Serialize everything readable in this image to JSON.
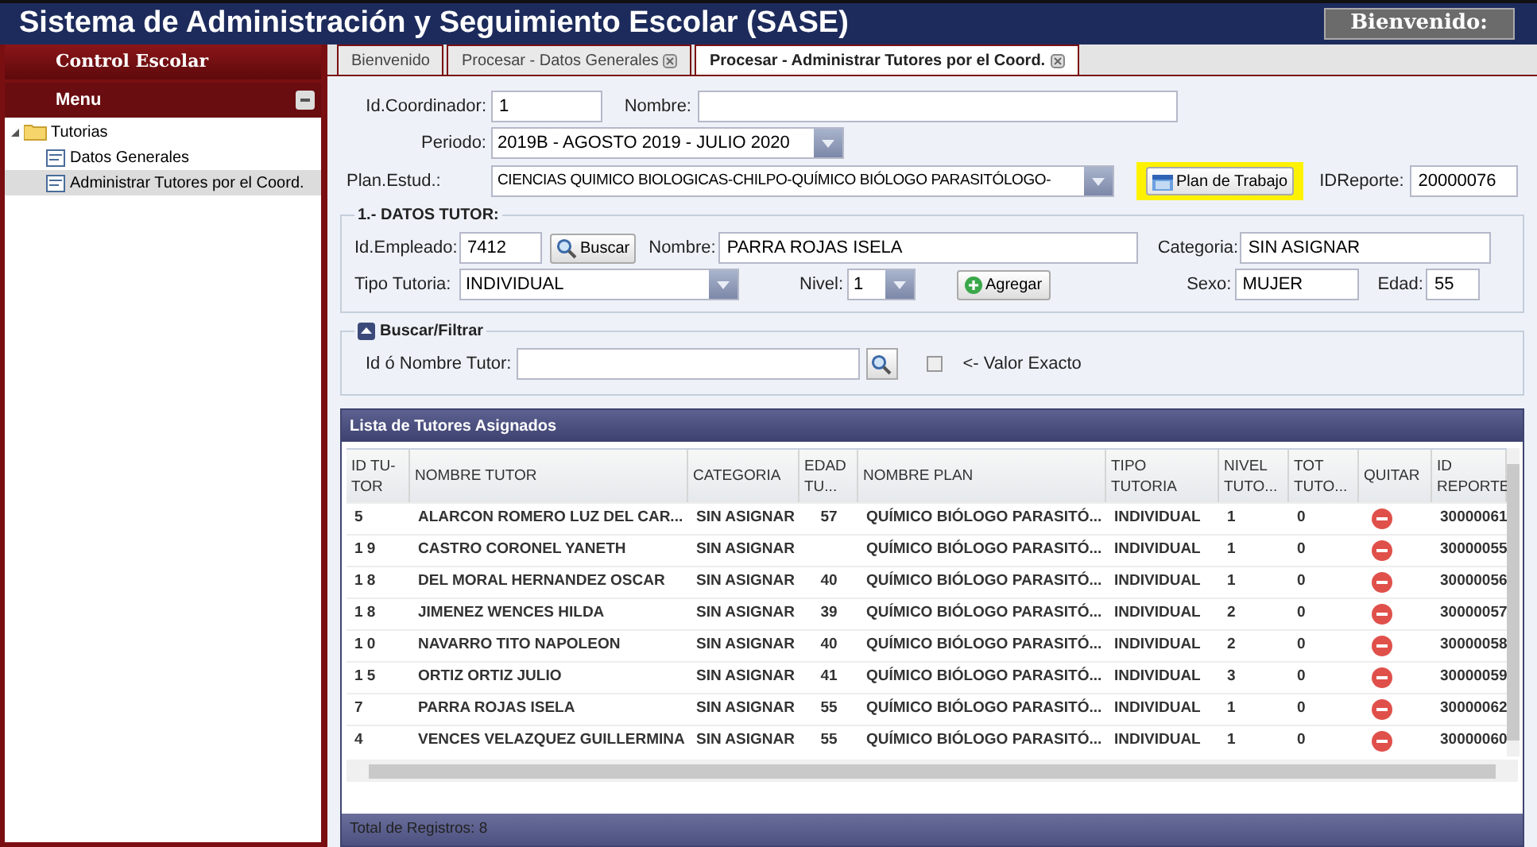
{
  "title": "Sistema de Administración y Seguimiento Escolar (SASE)",
  "welcome": "Bienvenido:",
  "sidebar": {
    "header": "Control Escolar",
    "menu": "Menu",
    "tree": [
      {
        "label": "Tutorias",
        "expanded": true,
        "children": [
          {
            "label": "Datos Generales",
            "selected": false
          },
          {
            "label": "Administrar Tutores por el Coord.",
            "selected": true
          }
        ]
      }
    ]
  },
  "tabs": [
    {
      "label": "Bienvenido",
      "closable": false,
      "selected": false
    },
    {
      "label": "Procesar - Datos Generales",
      "closable": true,
      "selected": false
    },
    {
      "label": "Procesar - Administrar Tutores por el Coord.",
      "closable": true,
      "selected": true
    }
  ],
  "form": {
    "id_coordinador": {
      "label": "Id.Coordinador:",
      "value": "1"
    },
    "nombre": {
      "label": "Nombre:"
    },
    "periodo": {
      "label": "Periodo:",
      "value": "2019B - AGOSTO 2019 - JULIO 2020"
    },
    "plan": {
      "label": "Plan.Estud.:",
      "value": "CIENCIAS QUIMICO BIOLOGICAS-CHILPO-QUÍMICO BIÓLOGO PARASITÓLOGO-"
    },
    "plan_button": "Plan de Trabajo",
    "id_reporte": {
      "label": "IDReporte:",
      "value": "20000076"
    }
  },
  "datos_tutor": {
    "legend": "1.- DATOS TUTOR:",
    "id_empleado": {
      "label": "Id.Empleado:",
      "value": "7412"
    },
    "buscar": "Buscar",
    "nombre": {
      "label": "Nombre:",
      "value": "PARRA ROJAS ISELA"
    },
    "categoria": {
      "label": "Categoria:",
      "value": "SIN ASIGNAR"
    },
    "tipo": {
      "label": "Tipo Tutoria:",
      "value": "INDIVIDUAL"
    },
    "nivel": {
      "label": "Nivel:",
      "value": "1"
    },
    "agregar": "Agregar",
    "sexo": {
      "label": "Sexo:",
      "value": "MUJER"
    },
    "edad": {
      "label": "Edad:",
      "value": "55"
    }
  },
  "filtro": {
    "legend": "Buscar/Filtrar",
    "label": "Id ó Nombre Tutor:",
    "exacto": {
      "label": "<- Valor Exacto",
      "checked": false
    }
  },
  "table": {
    "title": "Lista de Tutores Asignados",
    "columns": [
      "ID TU-TOR",
      "NOMBRE TUTOR",
      "CATEGORIA",
      "EDAD TU...",
      "NOMBRE PLAN",
      "TIPO TUTORIA",
      "NIVEL TUTO...",
      "TOT TUTO...",
      "QUITAR",
      "ID REPORTE"
    ],
    "rows": [
      {
        "id": "5",
        "nombre": "ALARCON ROMERO LUZ DEL CAR...",
        "categoria": "SIN ASIGNAR",
        "edad": "57",
        "plan": "QUÍMICO BIÓLOGO PARASITÓ...",
        "tipo": "INDIVIDUAL",
        "nivel": "1",
        "tot": "0",
        "reporte": "30000061"
      },
      {
        "id": "1 9",
        "nombre": "CASTRO CORONEL YANETH",
        "categoria": "SIN ASIGNAR",
        "plan": "QUÍMICO BIÓLOGO PARASITÓ...",
        "tipo": "INDIVIDUAL",
        "nivel": "1",
        "tot": "0",
        "reporte": "30000055"
      },
      {
        "id": "1 8",
        "nombre": "DEL MORAL HERNANDEZ OSCAR",
        "categoria": "SIN ASIGNAR",
        "edad": "40",
        "plan": "QUÍMICO BIÓLOGO PARASITÓ...",
        "tipo": "INDIVIDUAL",
        "nivel": "1",
        "tot": "0",
        "reporte": "30000056"
      },
      {
        "id": "1 8",
        "nombre": "JIMENEZ WENCES HILDA",
        "categoria": "SIN ASIGNAR",
        "edad": "39",
        "plan": "QUÍMICO BIÓLOGO PARASITÓ...",
        "tipo": "INDIVIDUAL",
        "nivel": "2",
        "tot": "0",
        "reporte": "30000057"
      },
      {
        "id": "1 0",
        "nombre": "NAVARRO TITO NAPOLEON",
        "categoria": "SIN ASIGNAR",
        "edad": "40",
        "plan": "QUÍMICO BIÓLOGO PARASITÓ...",
        "tipo": "INDIVIDUAL",
        "nivel": "2",
        "tot": "0",
        "reporte": "30000058"
      },
      {
        "id": "1 5",
        "nombre": "ORTIZ ORTIZ JULIO",
        "categoria": "SIN ASIGNAR",
        "edad": "41",
        "plan": "QUÍMICO BIÓLOGO PARASITÓ...",
        "tipo": "INDIVIDUAL",
        "nivel": "3",
        "tot": "0",
        "reporte": "30000059"
      },
      {
        "id": "7",
        "nombre": "PARRA ROJAS ISELA",
        "categoria": "SIN ASIGNAR",
        "edad": "55",
        "plan": "QUÍMICO BIÓLOGO PARASITÓ...",
        "tipo": "INDIVIDUAL",
        "nivel": "1",
        "tot": "0",
        "reporte": "30000062"
      },
      {
        "id": "4",
        "nombre": "VENCES VELAZQUEZ GUILLERMINA",
        "categoria": "SIN ASIGNAR",
        "edad": "55",
        "plan": "QUÍMICO BIÓLOGO PARASITÓ...",
        "tipo": "INDIVIDUAL",
        "nivel": "1",
        "tot": "0",
        "reporte": "30000060"
      }
    ],
    "footer": "Total de Registros: 8"
  }
}
